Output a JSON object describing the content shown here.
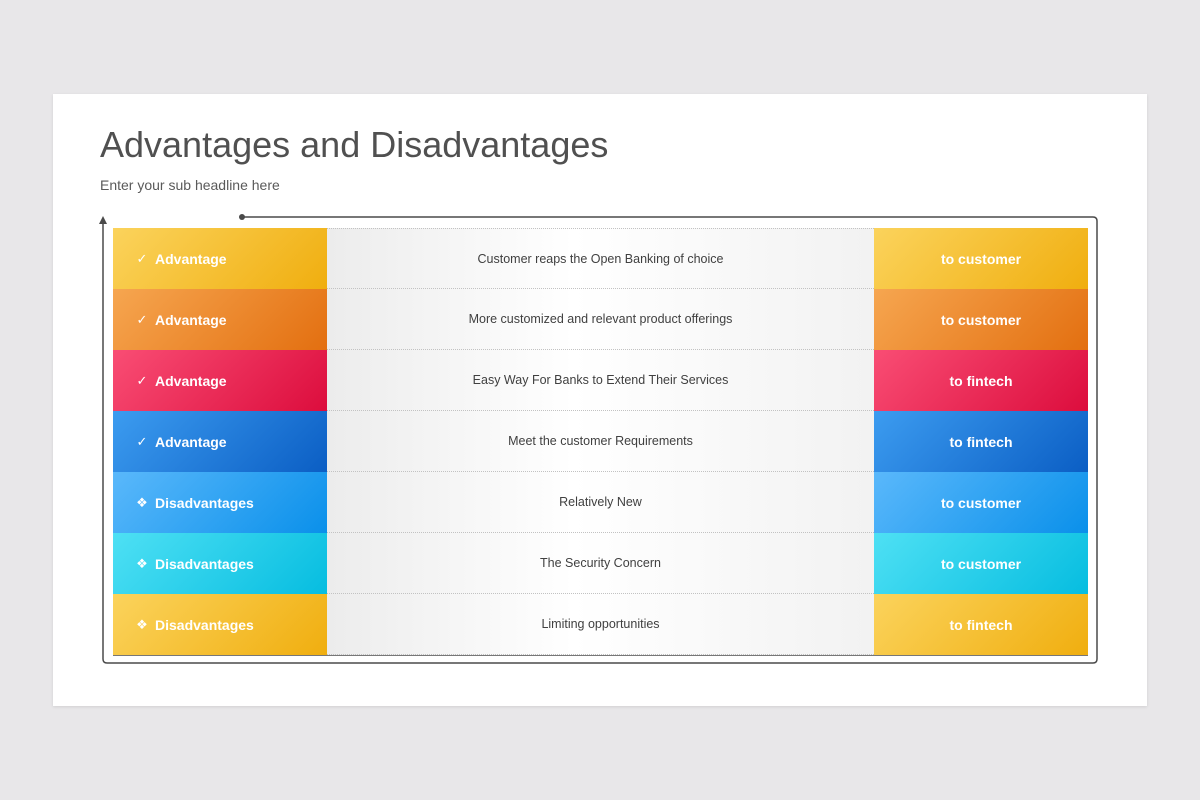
{
  "title": "Advantages and Disadvantages",
  "subtitle": "Enter your sub headline here",
  "rows": [
    {
      "label": "Advantage",
      "mark": "✓",
      "mark_icon": "check-icon",
      "description": "Customer reaps the Open Banking of choice",
      "target": "to customer",
      "color_light": "#fbd35c",
      "color_dark": "#f0ae0f"
    },
    {
      "label": "Advantage",
      "mark": "✓",
      "mark_icon": "check-icon",
      "description": "More customized and relevant product offerings",
      "target": "to customer",
      "color_light": "#f6a650",
      "color_dark": "#e36f10"
    },
    {
      "label": "Advantage",
      "mark": "✓",
      "mark_icon": "check-icon",
      "description": "Easy Way For Banks to Extend Their Services",
      "target": "to fintech",
      "color_light": "#f94d74",
      "color_dark": "#dc0d3d"
    },
    {
      "label": "Advantage",
      "mark": "✓",
      "mark_icon": "check-icon",
      "description": "Meet the customer Requirements",
      "target": "to fintech",
      "color_light": "#3c9cf0",
      "color_dark": "#0b5ec4"
    },
    {
      "label": "Disadvantages",
      "mark": "❖",
      "mark_icon": "diamond-bullet-icon",
      "description": "Relatively New",
      "target": "to customer",
      "color_light": "#5ab8fb",
      "color_dark": "#0a90ea"
    },
    {
      "label": "Disadvantages",
      "mark": "❖",
      "mark_icon": "diamond-bullet-icon",
      "description": "The Security Concern",
      "target": "to customer",
      "color_light": "#4ee0f4",
      "color_dark": "#06bde0"
    },
    {
      "label": "Disadvantages",
      "mark": "❖",
      "mark_icon": "diamond-bullet-icon",
      "description": "Limiting opportunities",
      "target": "to fintech",
      "color_light": "#fbd35c",
      "color_dark": "#f0ae0f"
    }
  ]
}
